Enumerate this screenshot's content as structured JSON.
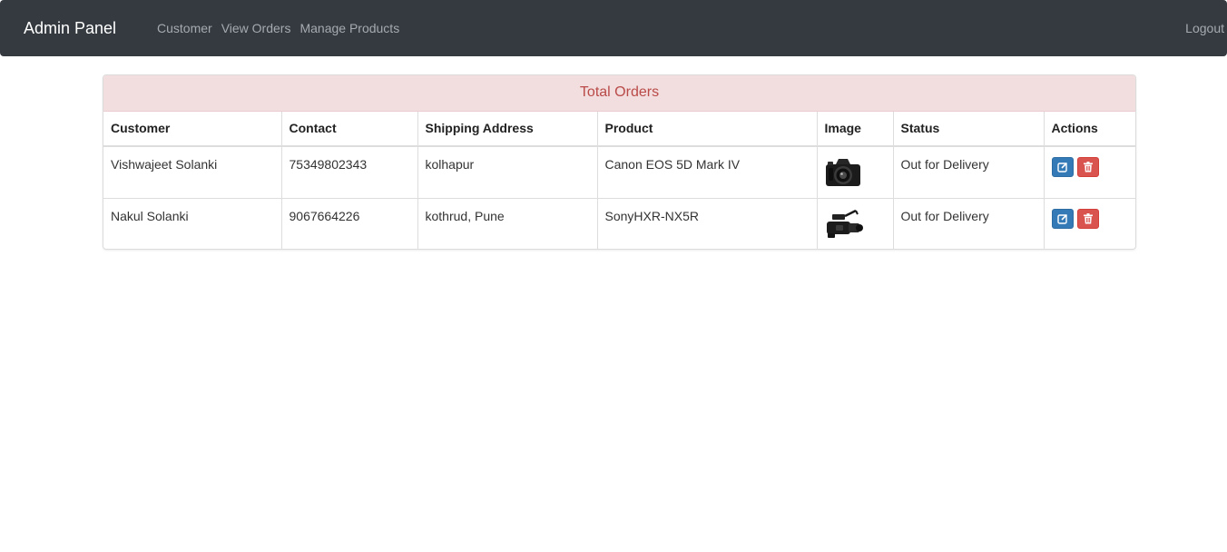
{
  "navbar": {
    "brand": "Admin Panel",
    "links": [
      "Customer",
      "View Orders",
      "Manage Products"
    ],
    "logout": "Logout"
  },
  "panel": {
    "title": "Total Orders"
  },
  "table": {
    "headers": [
      "Customer",
      "Contact",
      "Shipping Address",
      "Product",
      "Image",
      "Status",
      "Actions"
    ],
    "rows": [
      {
        "customer": "Vishwajeet Solanki",
        "contact": "75349802343",
        "address": "kolhapur",
        "product": "Canon EOS 5D Mark IV",
        "image_icon": "dslr-camera-icon",
        "status": "Out for Delivery"
      },
      {
        "customer": "Nakul Solanki",
        "contact": "9067664226",
        "address": "kothrud, Pune",
        "product": "SonyHXR-NX5R",
        "image_icon": "camcorder-icon",
        "status": "Out for Delivery"
      }
    ]
  },
  "colors": {
    "navbar_bg": "#343a40",
    "heading_bg": "#f2dede",
    "heading_text": "#b94a48",
    "edit_button": "#337ab7",
    "delete_button": "#d9534f"
  },
  "icons": {
    "edit": "edit-icon",
    "delete": "trash-icon"
  }
}
